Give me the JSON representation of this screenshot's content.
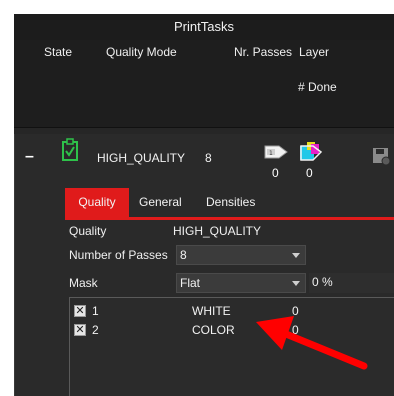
{
  "window": {
    "title": "PrintTasks"
  },
  "header": {
    "state": "State",
    "quality_mode": "Quality Mode",
    "nr_passes": "Nr. Passes",
    "layer": "Layer",
    "done": "# Done"
  },
  "job": {
    "collapse": "–",
    "quality_mode": "HIGH_QUALITY",
    "passes": "8",
    "layer1_count": "0",
    "layer2_count": "0"
  },
  "tabs": [
    {
      "label": "Quality",
      "active": true
    },
    {
      "label": "General",
      "active": false
    },
    {
      "label": "Densities",
      "active": false
    }
  ],
  "quality_panel": {
    "quality_label": "Quality",
    "quality_value": "HIGH_QUALITY",
    "passes_label": "Number of Passes",
    "passes_value": "8",
    "mask_label": "Mask",
    "mask_value": "Flat",
    "mask_percent": "0 %"
  },
  "layers": [
    {
      "checked": true,
      "index": "1",
      "name": "WHITE",
      "value": "0"
    },
    {
      "checked": true,
      "index": "2",
      "name": "COLOR",
      "value": "0"
    }
  ],
  "colors": {
    "accent": "#e01b1b",
    "background": "#2b2b2b",
    "header": "#1e1e1e",
    "annotation_arrow": "#ff0000"
  },
  "icons": [
    "collapse-icon",
    "checklist-status-icon",
    "white-layer-icon",
    "color-layer-icon",
    "save-icon",
    "checkbox-check-icon",
    "dropdown-arrow-icon",
    "annotation-arrow"
  ]
}
